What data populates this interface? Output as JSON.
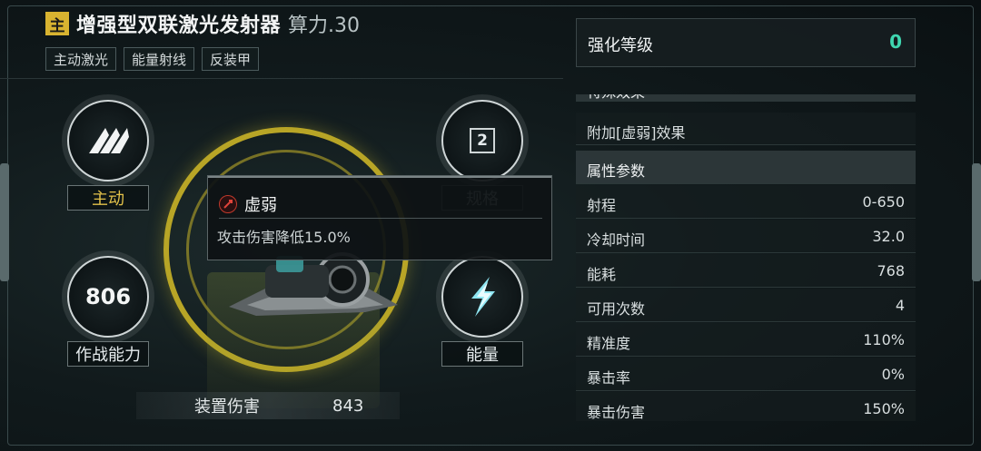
{
  "header": {
    "badge": "主",
    "title": "增强型双联激光发射器",
    "power": "算力.30",
    "tags": [
      "主动激光",
      "能量射线",
      "反装甲"
    ]
  },
  "nodes": {
    "type_label": "主动",
    "spec_value": "2",
    "spec_label": "规格",
    "combat_value": "806",
    "combat_label": "作战能力",
    "energy_label": "能量"
  },
  "device_damage": {
    "label": "装置伤害",
    "value": "843"
  },
  "tooltip": {
    "title": "虚弱",
    "description": "攻击伤害降低15.0%"
  },
  "panel": {
    "enhance_label": "强化等级",
    "enhance_value": "0",
    "special_effect_header": "特殊效果",
    "special_effect": "附加[虚弱]效果",
    "attributes_header": "属性参数",
    "attributes": [
      {
        "name": "射程",
        "value": "0-650"
      },
      {
        "name": "冷却时间",
        "value": "32.0"
      },
      {
        "name": "能耗",
        "value": "768"
      },
      {
        "name": "可用次数",
        "value": "4"
      },
      {
        "name": "精准度",
        "value": "110%"
      },
      {
        "name": "暴击率",
        "value": "0%"
      },
      {
        "name": "暴击伤害",
        "value": "150%"
      }
    ]
  },
  "colors": {
    "accent_gold": "#d8b330",
    "accent_teal": "#3fd6b0",
    "debuff_red": "#c0392b"
  }
}
